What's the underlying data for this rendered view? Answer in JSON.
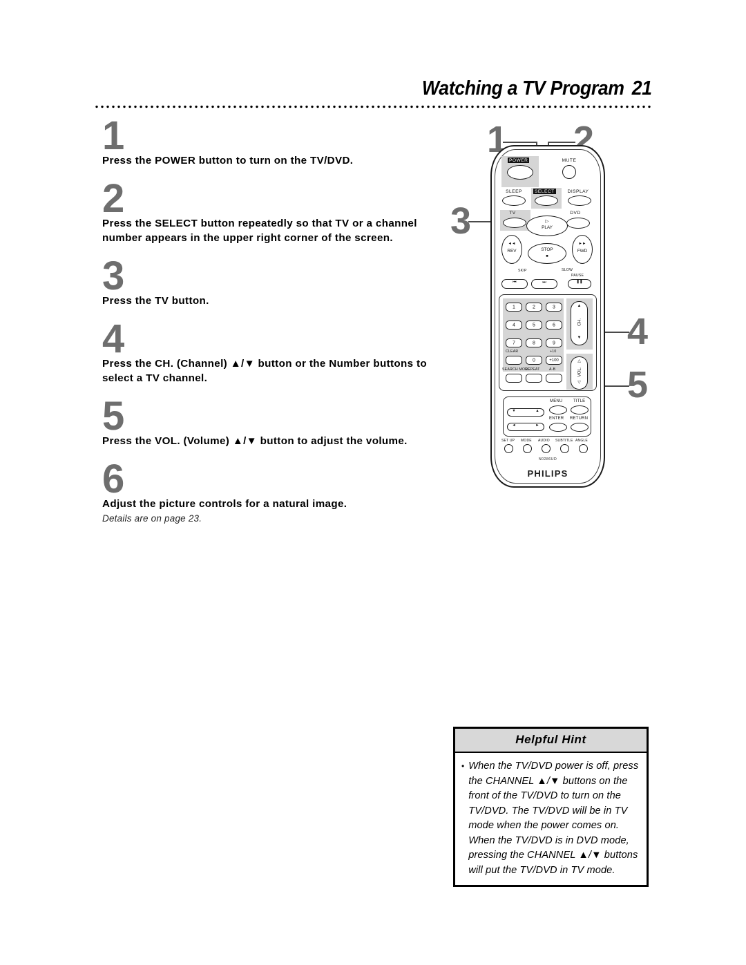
{
  "header": {
    "title": "Watching a TV Program",
    "page_number": "21"
  },
  "steps": [
    {
      "number": "1",
      "text": "Press the POWER button to turn on the TV/DVD."
    },
    {
      "number": "2",
      "text": "Press the SELECT button repeatedly so that TV or a channel number appears in the upper right corner of the screen."
    },
    {
      "number": "3",
      "text": "Press the TV button."
    },
    {
      "number": "4",
      "text": "Press the CH. (Channel) ▲/▼ button or the Number buttons to select a TV channel."
    },
    {
      "number": "5",
      "text": "Press the VOL. (Volume) ▲/▼ button to adjust the volume."
    },
    {
      "number": "6",
      "text": "Adjust the picture controls for a natural image.",
      "subtext": "Details are on page 23."
    }
  ],
  "remote": {
    "callouts": [
      "1",
      "2",
      "3",
      "4",
      "5"
    ],
    "brand": "PHILIPS",
    "model": "N0286UD",
    "buttons": {
      "power": "POWER",
      "mute": "MUTE",
      "sleep": "SLEEP",
      "select": "SELECT",
      "display": "DISPLAY",
      "tv": "TV",
      "dvd": "DVD",
      "play": "PLAY",
      "play_icon": "▷",
      "rev": "REV",
      "rev_icon": "◄◄",
      "fwd": "FWD",
      "fwd_icon": "►►",
      "stop": "STOP",
      "stop_icon": "■",
      "skip": "SKIP",
      "skip_back_icon": "⏮",
      "skip_fwd_icon": "⏭",
      "slow": "SLOW",
      "pause": "PAUSE",
      "pause_icon": "❚❚",
      "clear": "CLEAR",
      "plus_ten": "+10",
      "plus_hundred": "+100",
      "search_mode": "SEARCH MODE",
      "repeat": "REPEAT",
      "a_b": "A-B",
      "ch": "CH.",
      "vol": "VOL.",
      "menu": "MENU",
      "title": "TITLE",
      "enter": "ENTER",
      "return": "RETURN",
      "set_up": "SET UP",
      "mode": "MODE",
      "audio": "AUDIO",
      "subtitle": "SUBTITLE",
      "angle": "ANGLE",
      "up_icon": "▲",
      "down_icon": "▼",
      "left_icon": "◄",
      "right_icon": "►",
      "up_hollow": "△",
      "down_hollow": "▽"
    },
    "keypad": [
      "1",
      "2",
      "3",
      "4",
      "5",
      "6",
      "7",
      "8",
      "9",
      "0"
    ]
  },
  "hint": {
    "header": "Helpful Hint",
    "bullet": "•",
    "text": "When the TV/DVD power is off, press the CHANNEL ▲/▼ buttons on the front of the TV/DVD to turn on the TV/DVD. The TV/DVD will be in TV mode when the power comes on. When the TV/DVD is in DVD mode, pressing the CHANNEL ▲/▼ buttons will put the TV/DVD in TV mode."
  }
}
